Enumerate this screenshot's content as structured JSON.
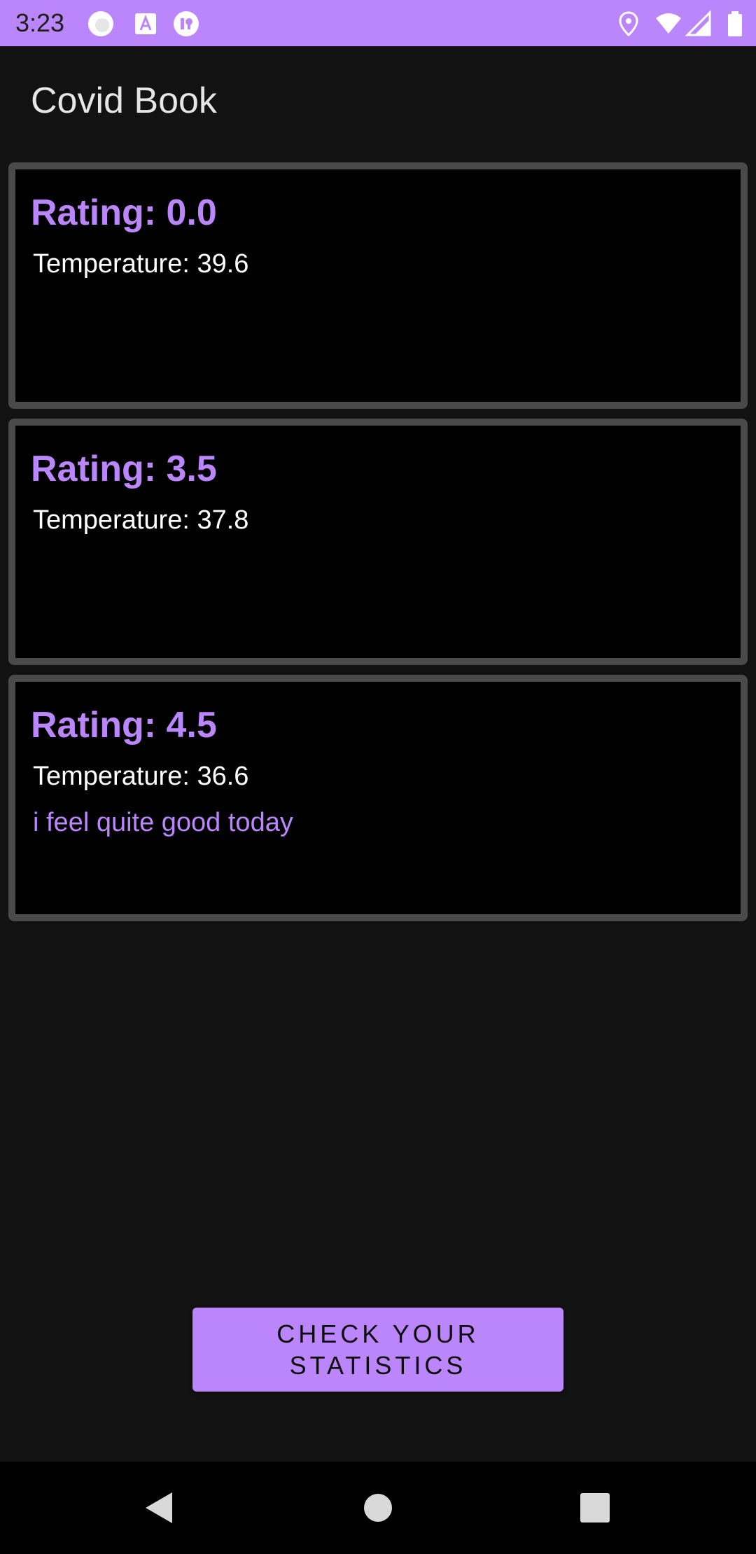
{
  "status_bar": {
    "time": "3:23",
    "icons": [
      "circle-icon",
      "font-a-icon",
      "app-badge-icon",
      "location-icon",
      "wifi-icon",
      "signal-icon",
      "battery-icon"
    ]
  },
  "app_bar": {
    "title": "Covid Book"
  },
  "entries": [
    {
      "rating": "Rating: 0.0",
      "temperature": "Temperature: 39.6",
      "note": ""
    },
    {
      "rating": "Rating: 3.5",
      "temperature": "Temperature: 37.8",
      "note": ""
    },
    {
      "rating": "Rating: 4.5",
      "temperature": "Temperature: 36.6",
      "note": "i feel quite good today"
    }
  ],
  "actions": {
    "stats_button_line1": "CHECK YOUR",
    "stats_button_line2": "STATISTICS"
  },
  "nav_bar": {
    "icons": [
      "back-icon",
      "home-icon",
      "recents-icon"
    ]
  },
  "colors": {
    "accent": "#bb86fc",
    "background": "#121212",
    "card": "#000000",
    "card_border": "#4a4a4a"
  }
}
